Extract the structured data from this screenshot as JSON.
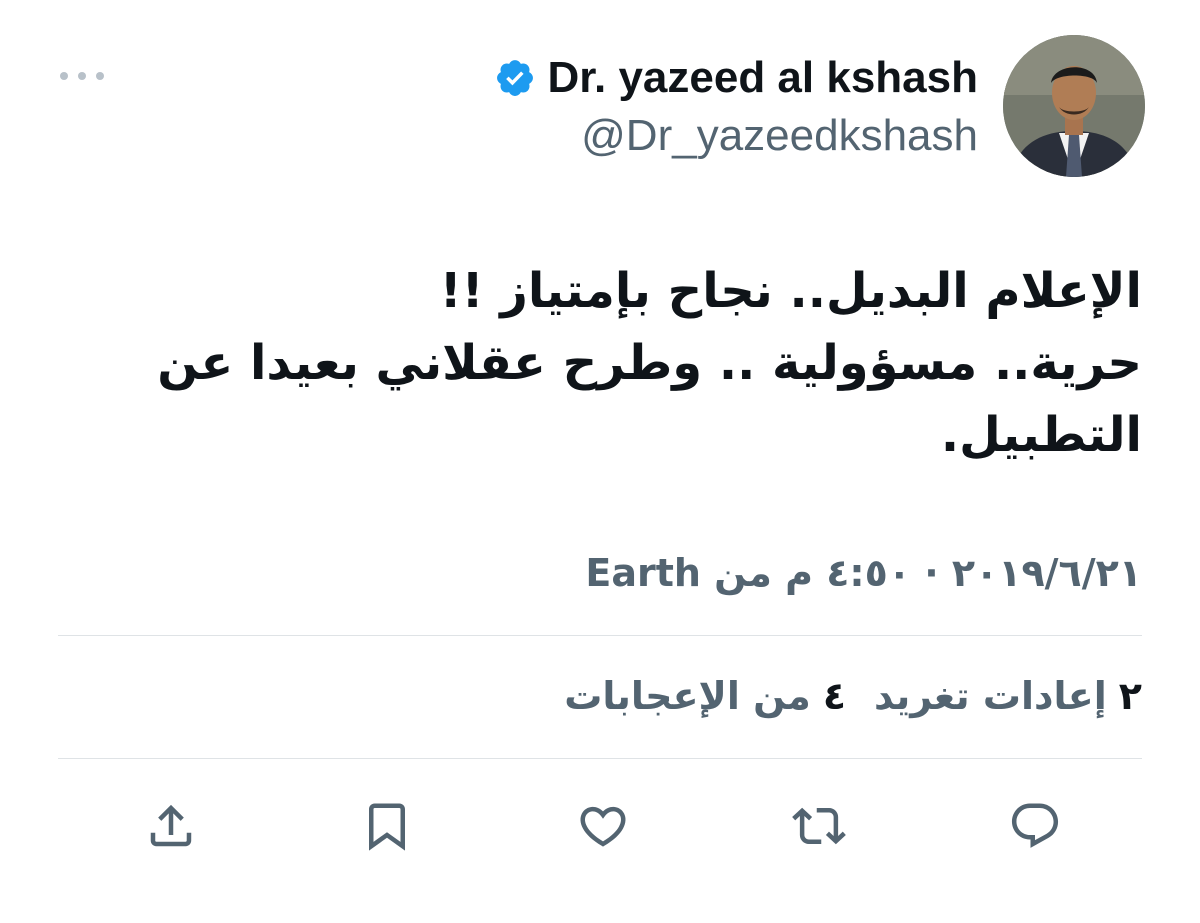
{
  "author": {
    "display_name": "Dr. yazeed al kshash",
    "handle": "@Dr_yazeedkshash",
    "verified": true
  },
  "tweet": {
    "lines": [
      "الإعلام البديل.. نجاح بإمتياز !!",
      "حرية.. مسؤولية .. وطرح عقلاني بعيدا عن",
      "التطبيل."
    ]
  },
  "meta": {
    "timestamp": "٢٠١٩/٦/٢١ · ٤:٥٠ م من Earth"
  },
  "stats": {
    "retweets_count": "٢",
    "retweets_label": "إعادات تغريد",
    "likes_count": "٤",
    "likes_label": "من الإعجابات"
  },
  "colors": {
    "text_primary": "#0f1419",
    "text_secondary": "#536471",
    "verified_blue": "#1d9bf0",
    "divider": "#dfe3e6",
    "icon_gray": "#536471"
  },
  "icons": {
    "more": "more-dots-icon",
    "verified": "verified-badge-icon",
    "reply": "reply-icon",
    "retweet": "retweet-icon",
    "like": "heart-icon",
    "bookmark": "bookmark-icon",
    "share": "share-icon"
  }
}
